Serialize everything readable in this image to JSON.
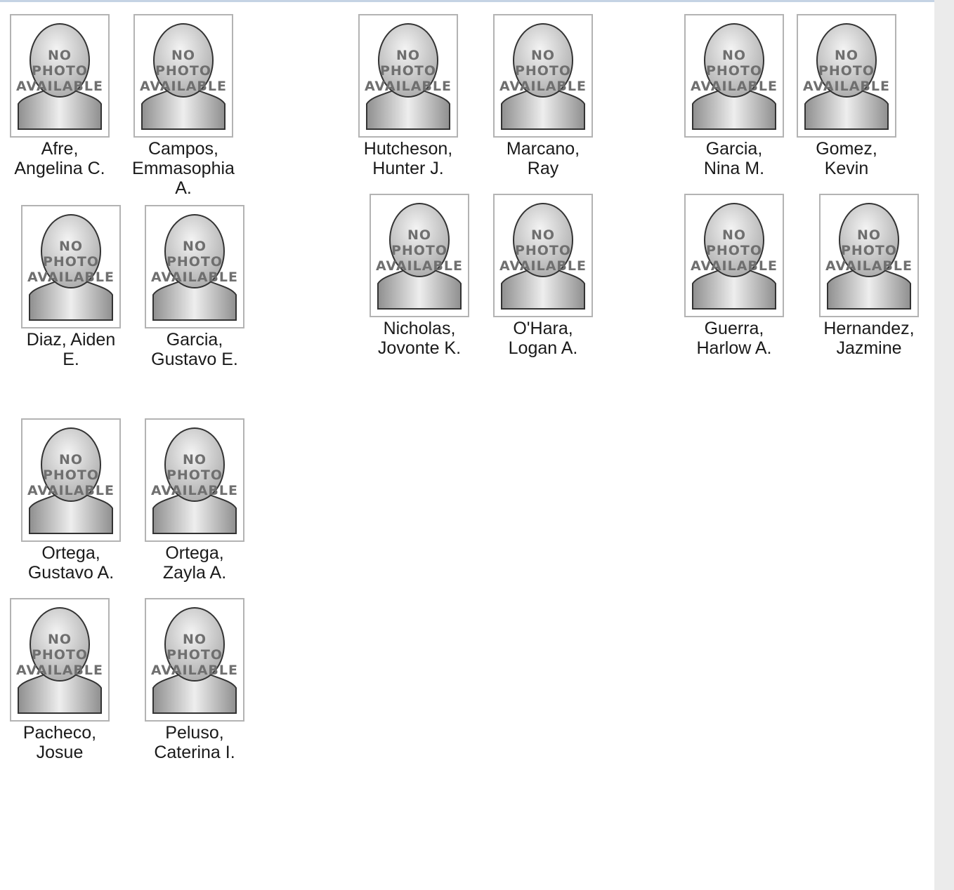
{
  "placeholder": {
    "line1": "NO",
    "line2": "PHOTO",
    "line3": "AVAILABLE"
  },
  "students": [
    {
      "last": "Afre,",
      "first": "Angelina C."
    },
    {
      "last": "Campos,",
      "first": "Emmasophia",
      "extra": "A."
    },
    {
      "last": "Hutcheson,",
      "first": "Hunter J."
    },
    {
      "last": "Marcano,",
      "first": "Ray"
    },
    {
      "last": "Garcia,",
      "first": "Nina M."
    },
    {
      "last": "Gomez,",
      "first": "Kevin"
    },
    {
      "last": "Diaz, Aiden",
      "first": "E."
    },
    {
      "last": "Garcia,",
      "first": "Gustavo E."
    },
    {
      "last": "Nicholas,",
      "first": "Jovonte K."
    },
    {
      "last": "O'Hara,",
      "first": "Logan A."
    },
    {
      "last": "Guerra,",
      "first": "Harlow A."
    },
    {
      "last": "Hernandez,",
      "first": "Jazmine"
    },
    {
      "last": "Ortega,",
      "first": "Gustavo A."
    },
    {
      "last": "Ortega,",
      "first": "Zayla A."
    },
    {
      "last": "Pacheco,",
      "first": "Josue"
    },
    {
      "last": "Peluso,",
      "first": "Caterina I."
    }
  ]
}
